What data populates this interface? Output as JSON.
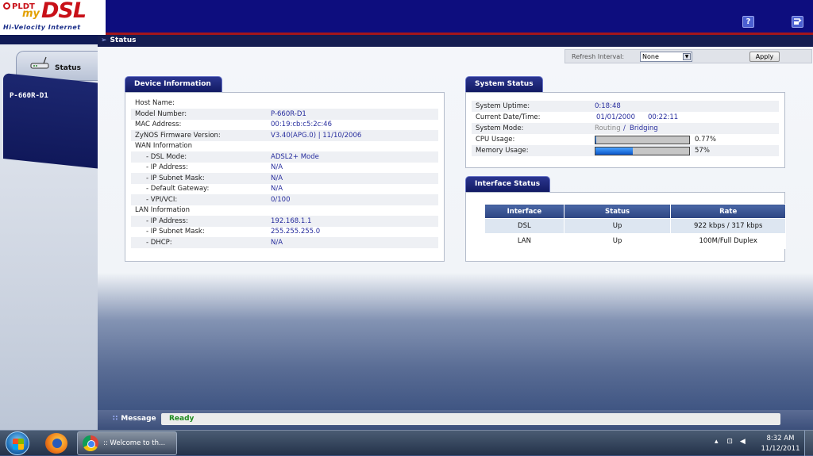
{
  "branding": {
    "pldt": "PLDT",
    "my": "my",
    "dsl": "DSL",
    "tagline": "Hi-Velocity Internet"
  },
  "header_icons": [
    "help-icon",
    "logout-icon"
  ],
  "sidebar": {
    "status_tab_label": "Status",
    "model_label": "P-660R-D1"
  },
  "breadcrumb": "Status",
  "refresh": {
    "label": "Refresh Interval:",
    "selected": "None",
    "apply_label": "Apply"
  },
  "device_info": {
    "title": "Device Information",
    "rows": [
      {
        "label": "Host Name:",
        "value": ""
      },
      {
        "label": "Model Number:",
        "value": "P-660R-D1"
      },
      {
        "label": "MAC Address:",
        "value": "00:19:cb:c5:2c:46"
      },
      {
        "label": "ZyNOS Firmware Version:",
        "value": "V3.40(APG.0) | 11/10/2006"
      },
      {
        "label": "WAN Information",
        "value": ""
      },
      {
        "label": "- DSL Mode:",
        "value": "ADSL2+ Mode"
      },
      {
        "label": "- IP Address:",
        "value": "N/A"
      },
      {
        "label": "- IP Subnet Mask:",
        "value": "N/A"
      },
      {
        "label": "- Default Gateway:",
        "value": "N/A"
      },
      {
        "label": "- VPI/VCI:",
        "value": "0/100"
      },
      {
        "label": "LAN Information",
        "value": ""
      },
      {
        "label": "- IP Address:",
        "value": "192.168.1.1"
      },
      {
        "label": "- IP Subnet Mask:",
        "value": "255.255.255.0"
      },
      {
        "label": "- DHCP:",
        "value": "N/A"
      }
    ]
  },
  "system_status": {
    "title": "System Status",
    "uptime_label": "System Uptime:",
    "uptime": "0:18:48",
    "datetime_label": "Current Date/Time:",
    "date": "01/01/2000",
    "time": "00:22:11",
    "mode_label": "System Mode:",
    "mode_routing": "Routing",
    "mode_sep": "/",
    "mode_bridging": "Bridging",
    "cpu_label": "CPU Usage:",
    "cpu_text": "0.77%",
    "cpu_fraction": 0.0077,
    "mem_label": "Memory Usage:",
    "mem_text": "57%",
    "mem_fraction": 0.57
  },
  "interface_status": {
    "title": "Interface Status",
    "headers": [
      "Interface",
      "Status",
      "Rate"
    ],
    "rows": [
      [
        "DSL",
        "Up",
        "922 kbps / 317 kbps"
      ],
      [
        "LAN",
        "Up",
        "100M/Full Duplex"
      ]
    ]
  },
  "message": {
    "label": "Message",
    "text": "Ready"
  },
  "taskbar": {
    "chrome_title": ":: Welcome to th...",
    "time": "8:32 AM",
    "date": "11/12/2011"
  },
  "colors": {
    "header_bg": "#0d0d7e",
    "accent_red": "#a3161b",
    "link_blue": "#262c9d",
    "ready_green": "#1e8a1e"
  }
}
